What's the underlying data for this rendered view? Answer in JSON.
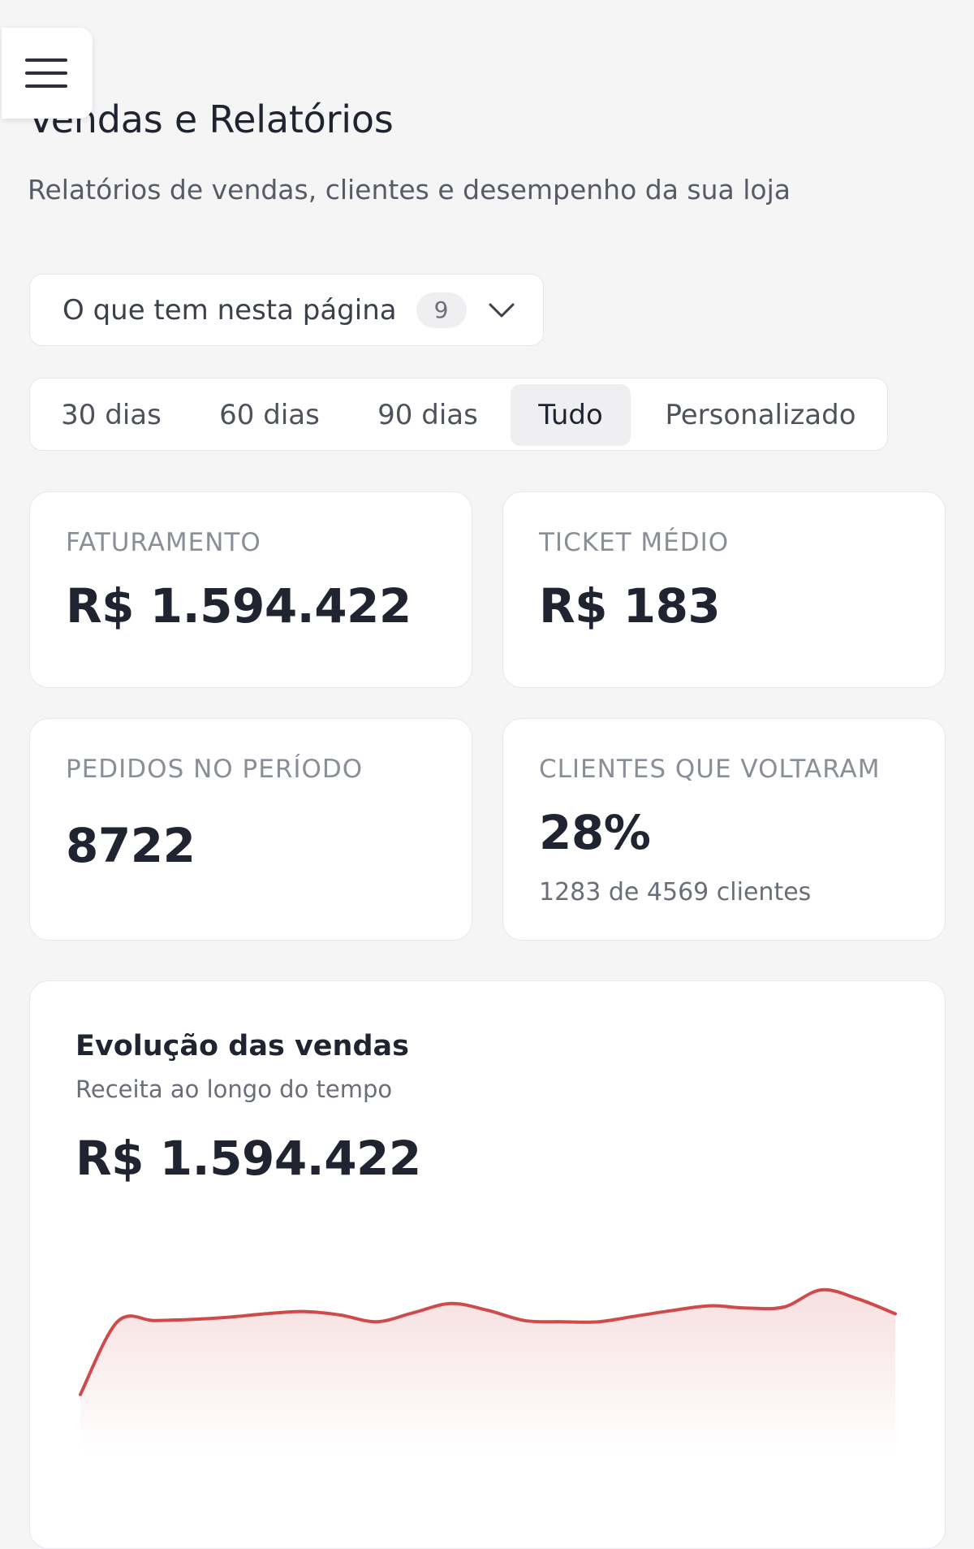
{
  "header": {
    "menu_icon": "hamburger-menu-icon",
    "title": "Vendas e Relatórios",
    "subtitle": "Relatórios de vendas, clientes e desempenho da sua loja"
  },
  "toc": {
    "label": "O que tem nesta página",
    "count": "9",
    "icon": "chevron-down-icon"
  },
  "period_tabs": {
    "items": [
      {
        "label": "30 dias",
        "active": false
      },
      {
        "label": "60 dias",
        "active": false
      },
      {
        "label": "90 dias",
        "active": false
      },
      {
        "label": "Tudo",
        "active": true
      },
      {
        "label": "Personalizado",
        "active": false
      }
    ]
  },
  "stats": {
    "revenue": {
      "label": "FATURAMENTO",
      "value": "R$ 1.594.422"
    },
    "ticket": {
      "label": "TICKET MÉDIO",
      "value": "R$ 183"
    },
    "orders": {
      "label": "PEDIDOS NO PERÍODO",
      "value": "8722"
    },
    "returning": {
      "label": "CLIENTES QUE VOLTARAM",
      "value": "28%",
      "note": "1283 de 4569 clientes"
    }
  },
  "sales_chart": {
    "title": "Evolução das vendas",
    "subtitle": "Receita ao longo do tempo",
    "total": "R$ 1.594.422",
    "line_color": "#cf4a4a",
    "fill_color": "#f6dcdc"
  },
  "chart_data": {
    "type": "area",
    "title": "Evolução das vendas",
    "subtitle": "Receita ao longo do tempo",
    "x": [
      0,
      1,
      2,
      3,
      4,
      5,
      6,
      7,
      8,
      9,
      10,
      11,
      12,
      13,
      14,
      15,
      16,
      17,
      18,
      19,
      20,
      21,
      22
    ],
    "values": [
      0.08,
      0.72,
      0.73,
      0.74,
      0.76,
      0.79,
      0.81,
      0.78,
      0.72,
      0.8,
      0.88,
      0.82,
      0.73,
      0.72,
      0.72,
      0.77,
      0.82,
      0.86,
      0.84,
      0.85,
      1.0,
      0.92,
      0.79
    ],
    "ylim": [
      0,
      1
    ],
    "grid": false,
    "legend": "none"
  }
}
